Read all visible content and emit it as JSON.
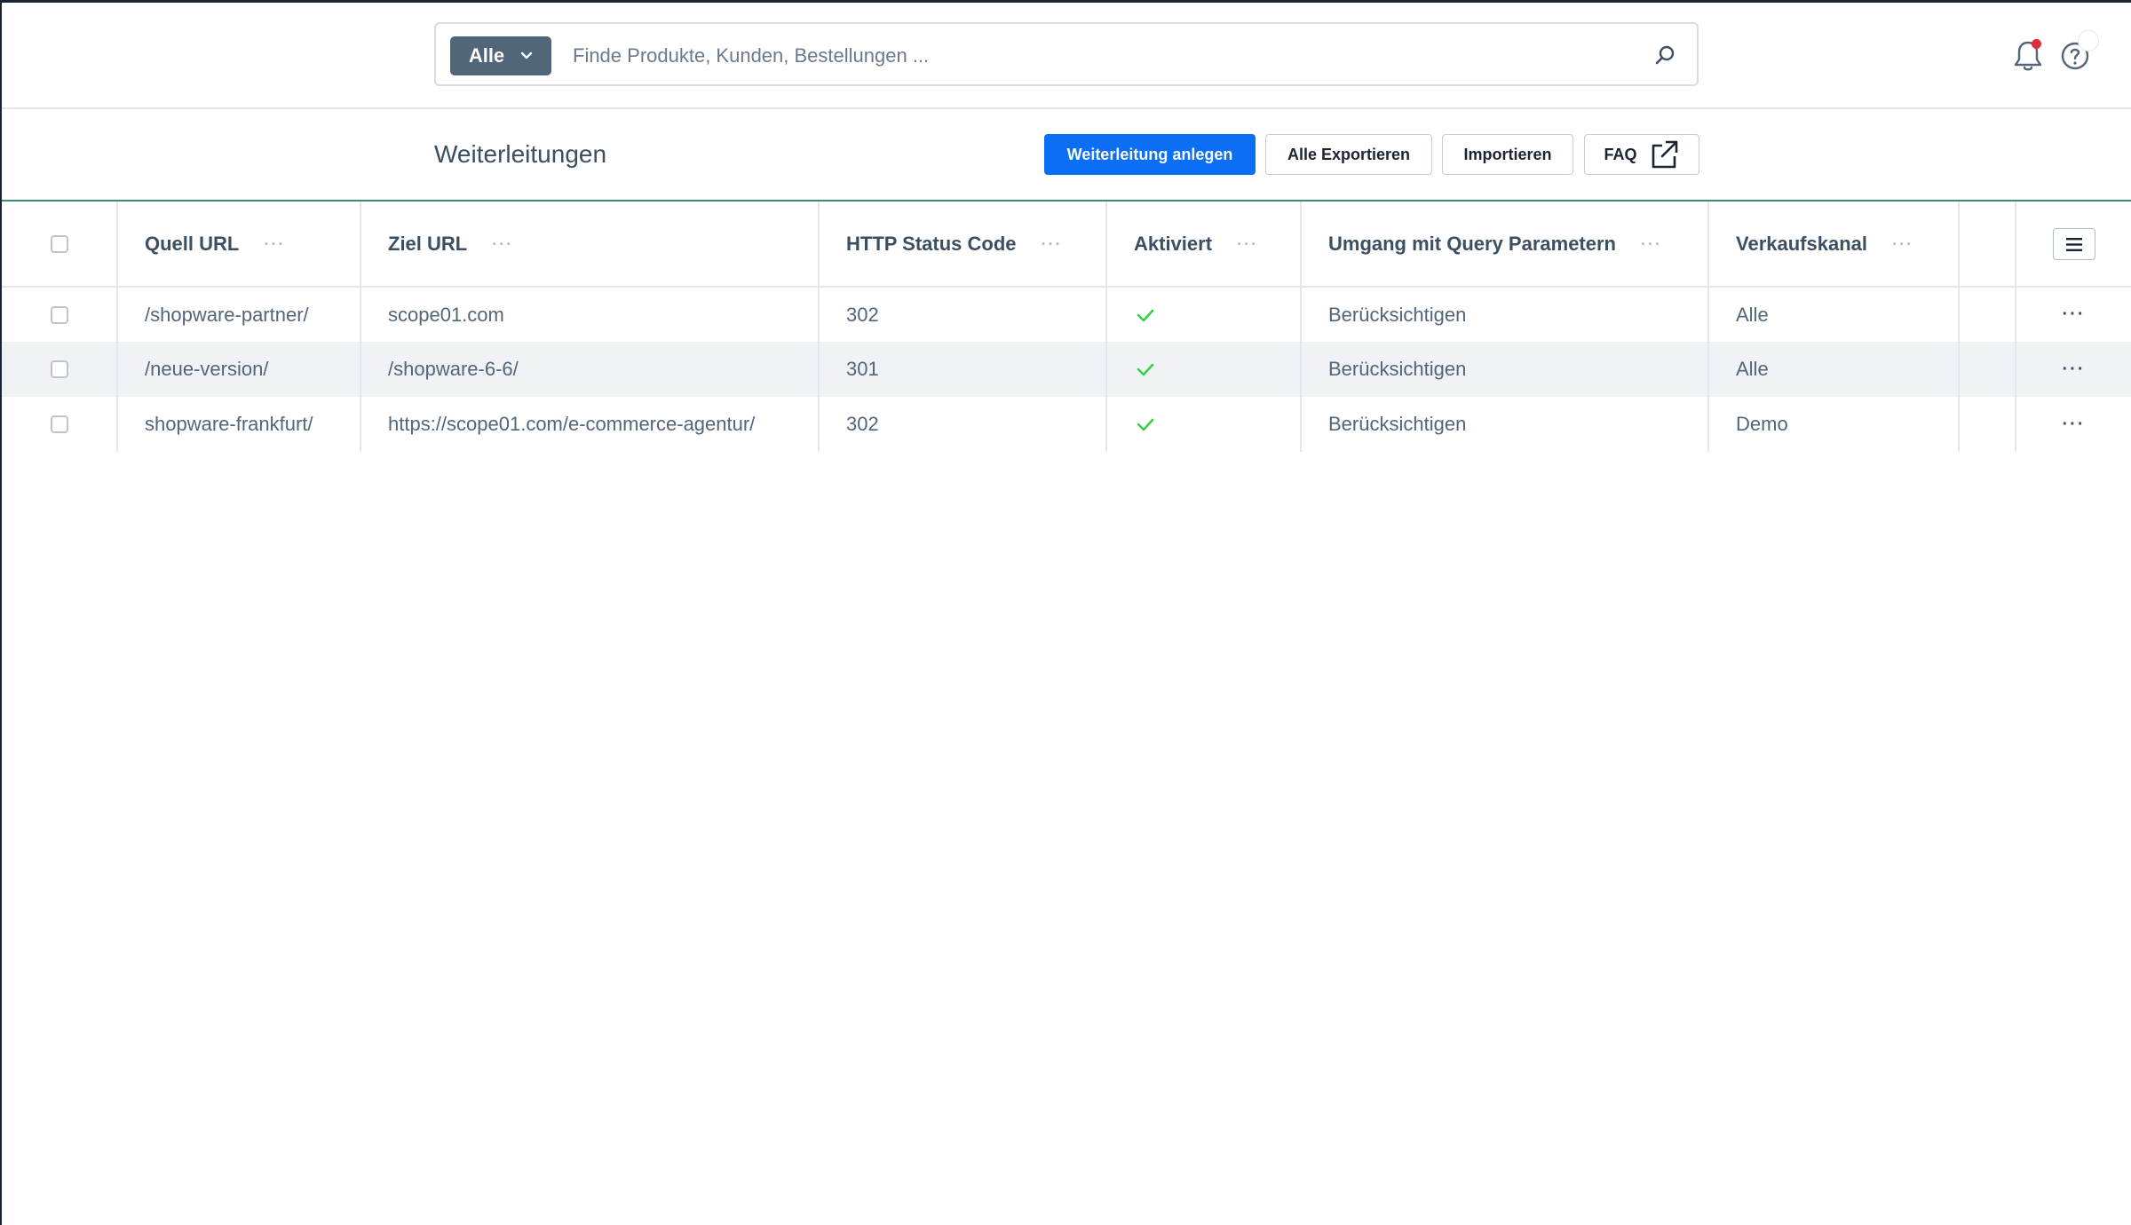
{
  "header": {
    "search": {
      "scope_label": "Alle",
      "placeholder": "Finde Produkte, Kunden, Bestellungen ..."
    },
    "icons": [
      "bell-icon",
      "help-icon",
      "search-icon",
      "chevron-down-icon"
    ]
  },
  "smartbar": {
    "title": "Weiterleitungen",
    "buttons": {
      "create": "Weiterleitung anlegen",
      "export": "Alle Exportieren",
      "import": "Importieren",
      "faq": "FAQ"
    },
    "faq_icon": "external-link-icon"
  },
  "table": {
    "columns": [
      "Quell URL",
      "Ziel URL",
      "HTTP Status Code",
      "Aktiviert",
      "Umgang mit Query Parametern",
      "Verkaufskanal"
    ],
    "rows": [
      {
        "source": "/shopware-partner/",
        "target": "scope01.com",
        "status": "302",
        "active": true,
        "query": "Berücksichtigen",
        "channel": "Alle"
      },
      {
        "source": "/neue-version/",
        "target": "/shopware-6-6/",
        "status": "301",
        "active": true,
        "query": "Berücksichtigen",
        "channel": "Alle"
      },
      {
        "source": "shopware-frankfurt/",
        "target": "https://scope01.com/e-commerce-agentur/",
        "status": "302",
        "active": true,
        "query": "Berücksichtigen",
        "channel": "Demo"
      }
    ]
  },
  "colors": {
    "primary": "#0b6ff5",
    "scope_bg": "#52667a",
    "check": "#37d046",
    "notification_dot": "#e02b3b",
    "row_alt": "#f0f2f5"
  }
}
